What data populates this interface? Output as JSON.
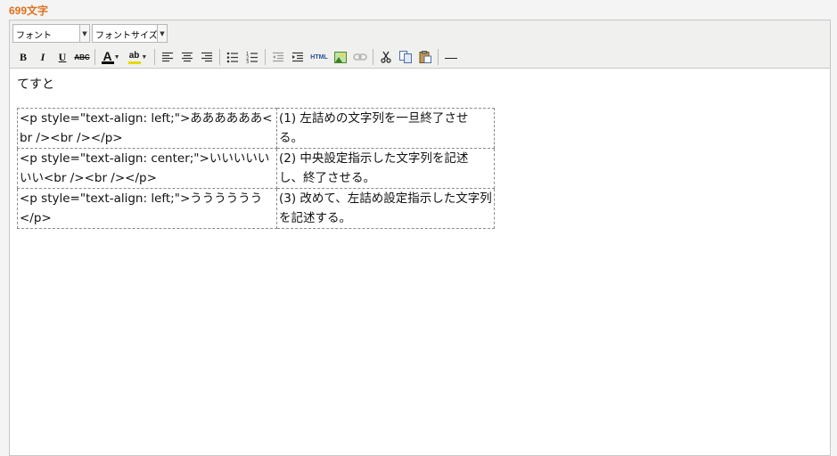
{
  "header": {
    "char_count": "699文字"
  },
  "toolbar": {
    "font_select": {
      "label": "フォント"
    },
    "font_size_select": {
      "label": "フォントサイズ"
    },
    "bold": "B",
    "italic": "I",
    "underline": "U",
    "strikethrough": "ABC",
    "text_color": {
      "glyph": "A",
      "color": "#000000"
    },
    "highlight": {
      "glyph": "ab",
      "color": "#ffff00"
    },
    "html_button": "HTML",
    "horizontal_rule": "—"
  },
  "content": {
    "first_line": "てすと",
    "table": {
      "rows": [
        [
          "<p style=\"text-align: left;\">ああああああ<br /><br /></p>",
          "(1) 左詰めの文字列を一旦終了させる。"
        ],
        [
          "<p style=\"text-align: center;\">いいいいいいい<br /><br /></p>",
          "(2) 中央設定指示した文字列を記述し、終了させる。"
        ],
        [
          "<p style=\"text-align: left;\">うううううう</p>",
          "(3) 改めて、左詰め設定指示した文字列を記述する。"
        ]
      ]
    }
  },
  "colors": {
    "accent": "#e0711c",
    "toolbar_bg": "#f0f0ee",
    "border": "#c8c8c8"
  }
}
